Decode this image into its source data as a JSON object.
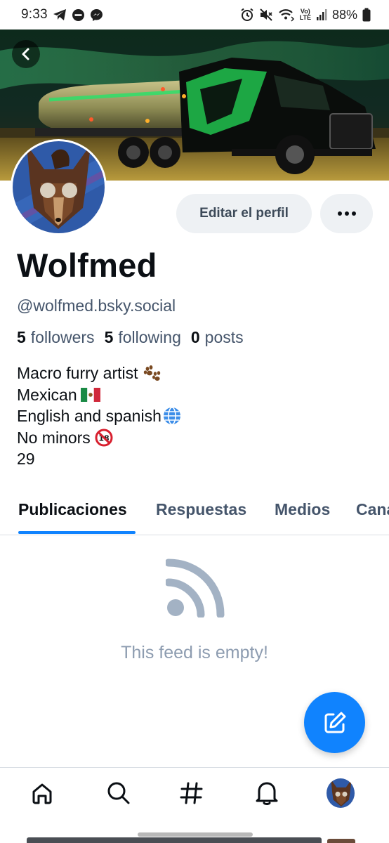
{
  "status_bar": {
    "time": "9:33",
    "battery": "88%",
    "left_icons": [
      "telegram-icon",
      "do-not-disturb-icon",
      "messenger-icon"
    ],
    "right_icons": [
      "alarm-icon",
      "mute-icon",
      "wifi-call-icon",
      "volte-icon",
      "signal-icon",
      "battery-icon"
    ],
    "volte_label_top": "Vo)",
    "volte_label_bottom": "LTE"
  },
  "profile": {
    "display_name": "Wolfmed",
    "handle": "@wolfmed.bsky.social",
    "edit_label": "Editar el perfil",
    "more_label": "•••",
    "stats": [
      {
        "value": "5",
        "label": "followers"
      },
      {
        "value": "5",
        "label": "following"
      },
      {
        "value": "0",
        "label": "posts"
      }
    ],
    "bio": [
      {
        "text": "Macro furry artist",
        "emoji": "paw-prints-icon"
      },
      {
        "text": "Mexican",
        "emoji": "mexico-flag-icon"
      },
      {
        "text": "English and spanish",
        "emoji": "globe-icon"
      },
      {
        "text": "No minors",
        "emoji": "no-under-18-icon"
      },
      {
        "text": "29",
        "emoji": ""
      }
    ]
  },
  "tabs": [
    {
      "label": "Publicaciones",
      "active": true
    },
    {
      "label": "Respuestas",
      "active": false
    },
    {
      "label": "Medios",
      "active": false
    },
    {
      "label": "Canal",
      "active": false
    }
  ],
  "feed": {
    "empty_message": "This feed is empty!",
    "empty_icon": "rss-feed-icon"
  },
  "bottom_nav": [
    "home-icon",
    "search-icon",
    "hashtag-icon",
    "notifications-icon",
    "profile-avatar"
  ],
  "colors": {
    "accent": "#1083fe",
    "muted_text": "#45556b",
    "empty_text": "#8d9cb0",
    "button_bg": "#eef1f4"
  }
}
